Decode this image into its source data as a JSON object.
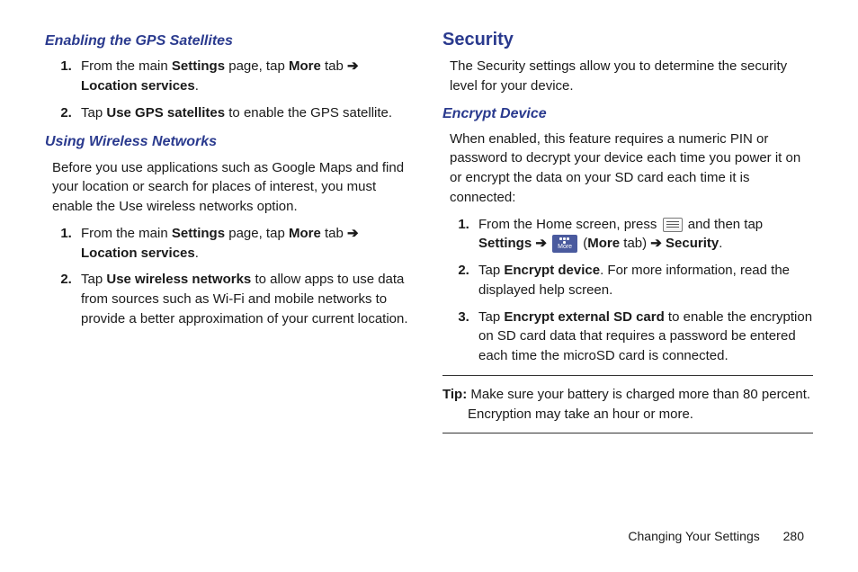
{
  "left": {
    "h3a": "Enabling the GPS Satellites",
    "s1a_pre": "From the main ",
    "s1a_b1": "Settings",
    "s1a_mid": " page, tap ",
    "s1a_b2": "More",
    "s1a_tab": " tab ",
    "s1a_arrow": "➔",
    "s1a_b3": "Location services",
    "s1a_post": ".",
    "s2a_pre": "Tap ",
    "s2a_b1": "Use GPS satellites",
    "s2a_post": " to enable the GPS satellite.",
    "h3b": "Using Wireless Networks",
    "pb": "Before you use applications such as Google Maps and find your location or search for places of interest, you must enable the Use wireless networks option.",
    "s1b_pre": "From the main ",
    "s1b_b1": "Settings",
    "s1b_mid": " page, tap ",
    "s1b_b2": "More",
    "s1b_tab": " tab ",
    "s1b_arrow": "➔",
    "s1b_b3": "Location services",
    "s1b_post": ".",
    "s2b_pre": "Tap ",
    "s2b_b1": "Use wireless networks",
    "s2b_post": " to allow apps to use data from sources such as Wi-Fi and mobile networks to provide a better approximation of your current location."
  },
  "right": {
    "h2": "Security",
    "p1": "The Security settings allow you to determine the security level for your device.",
    "h3": "Encrypt Device",
    "p2": "When enabled, this feature requires a numeric PIN or password to decrypt your device each time you power it on or encrypt the data on your SD card each time it is connected:",
    "s1_pre": "From the Home screen, press ",
    "s1_mid1": " and then tap ",
    "s1_b1": "Settings",
    "s1_arrow1": " ➔ ",
    "s1_paren1": " (",
    "s1_b2": "More",
    "s1_paren2": " tab) ",
    "s1_arrow2": "➔",
    "s1_b3": " Security",
    "s1_post": ".",
    "s2_pre": "Tap ",
    "s2_b1": "Encrypt device",
    "s2_post": ". For more information, read the displayed help screen.",
    "s3_pre": "Tap ",
    "s3_b1": "Encrypt external SD card",
    "s3_post": " to enable the encryption on SD card data that requires a password be entered each time the microSD card is connected.",
    "tip_label": "Tip:",
    "tip_text1": " Make sure your battery is charged more than 80 percent.",
    "tip_text2": "Encryption may take an hour or more."
  },
  "footer": {
    "section": "Changing Your Settings",
    "page": "280"
  }
}
